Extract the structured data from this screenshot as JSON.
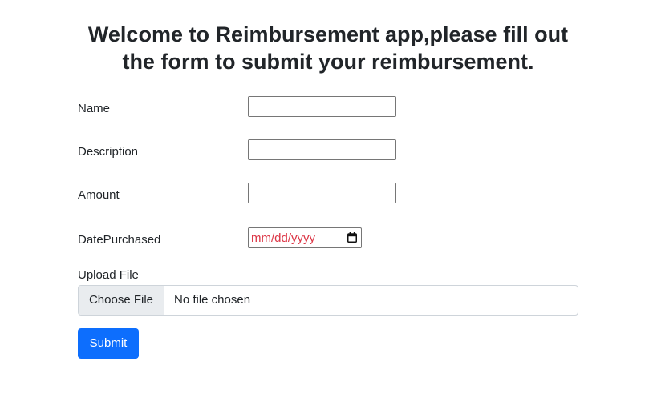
{
  "page": {
    "heading": "Welcome to Reimbursement app,please fill out the form to submit your reimbursement."
  },
  "form": {
    "name": {
      "label": "Name",
      "value": ""
    },
    "description": {
      "label": "Description",
      "value": ""
    },
    "amount": {
      "label": "Amount",
      "value": ""
    },
    "date_purchased": {
      "label": "DatePurchased",
      "placeholder": "mm/dd/yyyy",
      "icon": "calendar-icon"
    },
    "upload": {
      "label": "Upload File",
      "button_label": "Choose File",
      "status": "No file chosen"
    },
    "submit_label": "Submit"
  },
  "colors": {
    "primary": "#0d6efd",
    "date_placeholder": "#dc3545",
    "file_button_bg": "#e9ecef"
  }
}
